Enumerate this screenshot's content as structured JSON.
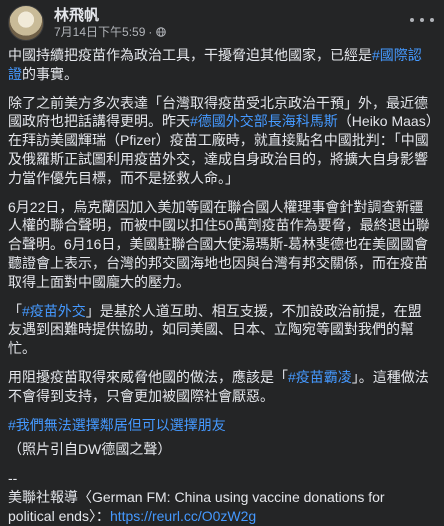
{
  "author": {
    "name": "林飛帆"
  },
  "meta": {
    "date": "7月14日下午5:59",
    "dot": "·"
  },
  "content": {
    "p1": {
      "t1": "中國持續把疫苗作為政治工具，干擾脅迫其他國家，已經是",
      "h1": "#國際認證",
      "t2": "的事實。"
    },
    "p2": {
      "t1": "除了之前美方多次表達「台灣取得疫苗受北京政治干預」外，最近德國政府也把話講得更明。昨天",
      "h1": "#德國外交部長海科馬斯",
      "t2": "（Heiko Maas）在拜訪美國輝瑞（Pfizer）疫苗工廠時，就直接點名中國批判：「中國及俄羅斯正試圖利用疫苗外交，達成自身政治目的，將擴大自身影響力當作優先目標，而不是拯救人命。」"
    },
    "p3": {
      "t1": "6月22日，烏克蘭因加入美加等國在聯合國人權理事會針對調查新疆人權的聯合聲明，而被中國以扣住50萬劑疫苗作為要脅，最終退出聯合聲明。6月16日，美國駐聯合國大使湯瑪斯-葛林斐德也在美國國會聽證會上表示，台灣的邦交國海地也因與台灣有邦交關係，而在疫苗取得上面對中國龐大的壓力。"
    },
    "p4": {
      "t1": "「",
      "h1": "#疫苗外交",
      "t2": "」是基於人道互助、相互支援，不加設政治前提，在盟友遇到困難時提供協助，如同美國、日本、立陶宛等國對我們的幫忙。"
    },
    "p5": {
      "t1": "用阻擾疫苗取得來威脅他國的做法，應該是「",
      "h1": "#疫苗霸凌",
      "t2": "」。這種做法不會得到支持，只會更加被國際社會厭惡。"
    },
    "p6": {
      "h1": "#我們無法選擇鄰居但可以選擇朋友"
    },
    "p7": {
      "t1": "（照片引自DW德國之聲）"
    },
    "p8": {
      "t1": "--",
      "t2": "美聯社報導〈German FM: China using vaccine donations for political ends〉：",
      "link": "https://reurl.cc/O0zW2g"
    }
  },
  "colors": {
    "background": "#242526",
    "text": "#e4e6eb",
    "link": "#4599ff",
    "muted": "#b0b3b8"
  },
  "icons": {
    "privacy": "globe-icon",
    "options": "more-options-icon"
  }
}
